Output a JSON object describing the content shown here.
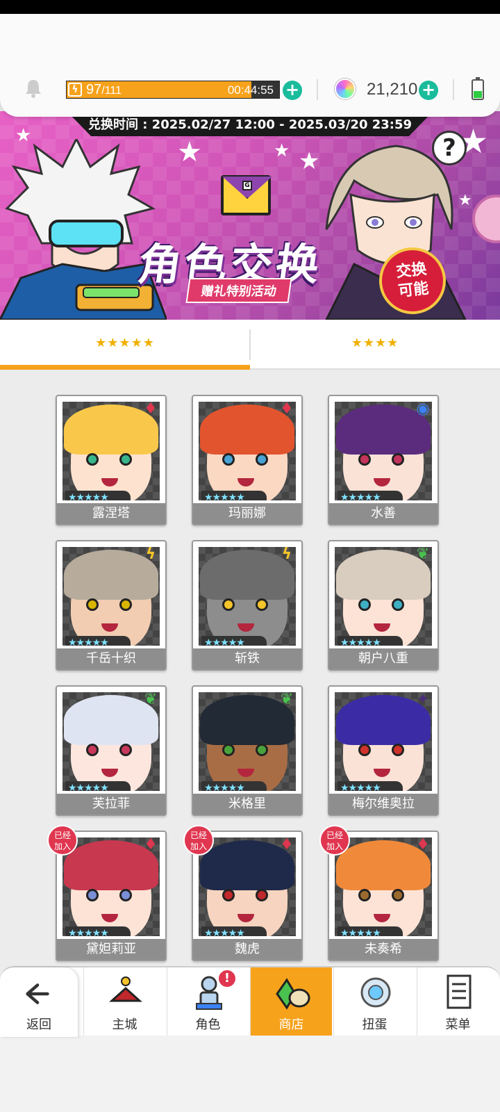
{
  "header": {
    "energy_current": "97",
    "energy_max": "/111",
    "energy_fraction": 0.87,
    "energy_timer": "00:44:55",
    "gems": "21,210"
  },
  "banner": {
    "exchange_time": "兑换时间 : 2025.02/27 12:00 - 2025.03/20 23:59",
    "title": "角色交换",
    "subtitle": "赠礼特别活动",
    "badge": "交换\n可能",
    "help": "?"
  },
  "tabs": [
    {
      "label": "★★★★★",
      "active": true
    },
    {
      "label": "★★★★",
      "active": false
    }
  ],
  "characters": [
    {
      "name": "露涅塔",
      "stars": "★★★★★",
      "element": "diamond-icon",
      "joined": false,
      "hair": "#f9c84a",
      "skin": "#fde3cf",
      "eye": "#39b58b"
    },
    {
      "name": "玛丽娜",
      "stars": "★★★★★",
      "element": "diamond-icon",
      "joined": false,
      "hair": "#e2542e",
      "skin": "#fbd8c2",
      "eye": "#4aa3d4"
    },
    {
      "name": "水善",
      "stars": "★★★★★",
      "element": "ring-icon",
      "joined": false,
      "hair": "#5b2c7e",
      "skin": "#fbe2d6",
      "eye": "#c3345c"
    },
    {
      "name": "千岳十织",
      "stars": "★★★★★",
      "element": "lightning-icon",
      "joined": false,
      "hair": "#b7ac9c",
      "skin": "#f2cdb1",
      "eye": "#d9b400"
    },
    {
      "name": "斩铁",
      "stars": "★★★★★",
      "element": "lightning-icon",
      "joined": false,
      "hair": "#6c6c6c",
      "skin": "#8d8d8d",
      "eye": "#f5c42a"
    },
    {
      "name": "朝户八重",
      "stars": "★★★★★",
      "element": "leaf-icon",
      "joined": false,
      "hair": "#d9cdbf",
      "skin": "#fde3d6",
      "eye": "#3fb0c4"
    },
    {
      "name": "芙拉菲",
      "stars": "★★★★★",
      "element": "leaf-icon",
      "joined": false,
      "hair": "#dfe4f3",
      "skin": "#fde6de",
      "eye": "#c7385a"
    },
    {
      "name": "米格里",
      "stars": "★★★★★",
      "element": "leaf-icon",
      "joined": false,
      "hair": "#222a35",
      "skin": "#a96d45",
      "eye": "#49a33b"
    },
    {
      "name": "梅尔维奥拉",
      "stars": "★★★★★",
      "element": "sparkle-icon",
      "joined": false,
      "hair": "#3b2ca6",
      "skin": "#fbe2d6",
      "eye": "#d0322c"
    },
    {
      "name": "黛妲莉亚",
      "stars": "★★★★★",
      "element": "diamond-icon",
      "joined": true,
      "hair": "#c8384f",
      "skin": "#fde3d6",
      "eye": "#7a8fd6"
    },
    {
      "name": "魏虎",
      "stars": "★★★★★",
      "element": "diamond-icon",
      "joined": true,
      "hair": "#1f2a4a",
      "skin": "#f6d4bf",
      "eye": "#c0282c"
    },
    {
      "name": "未奏希",
      "stars": "★★★★★",
      "element": "diamond-icon",
      "joined": true,
      "hair": "#f08a3a",
      "skin": "#fde3d6",
      "eye": "#9b6a2e"
    }
  ],
  "joined_label": "已经\n加入",
  "nav": {
    "back": "返回",
    "items": [
      {
        "label": "主城",
        "icon": "castle-icon",
        "active": false,
        "alert": false
      },
      {
        "label": "角色",
        "icon": "character-icon",
        "active": false,
        "alert": true
      },
      {
        "label": "商店",
        "icon": "shop-icon",
        "active": true,
        "alert": false
      },
      {
        "label": "扭蛋",
        "icon": "gacha-icon",
        "active": false,
        "alert": false
      },
      {
        "label": "菜单",
        "icon": "menu-icon",
        "active": false,
        "alert": false
      }
    ],
    "alert_mark": "!"
  },
  "colors": {
    "accent": "#f7a21b",
    "plus": "#1abc9c",
    "fire": "#e0364f",
    "lightning": "#f5c42a",
    "wood": "#49c24f",
    "water": "#3b82f6",
    "dark": "#4a2d7a"
  }
}
